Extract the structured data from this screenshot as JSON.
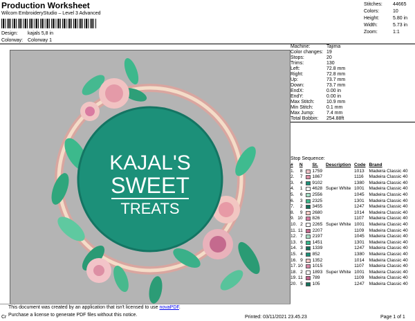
{
  "header": {
    "title": "Production Worksheet",
    "subtitle": "Wilcom EmbroideryStudio – Level 3 Advanced",
    "design_label": "Design:",
    "design_value": "kajals 5,8 in",
    "colorway_label": "Colorway:",
    "colorway_value": "Colorway 1"
  },
  "summary": [
    {
      "label": "Stitches:",
      "value": "44665"
    },
    {
      "label": "Colors:",
      "value": "10"
    },
    {
      "label": "Height:",
      "value": "5.80 in"
    },
    {
      "label": "Width:",
      "value": "5.73 in"
    },
    {
      "label": "Zoom:",
      "value": "1:1"
    }
  ],
  "logo": {
    "line1": "KAJAL'S",
    "line2": "SWEET",
    "line3": "TREATS"
  },
  "machine_info": [
    {
      "label": "Machine:",
      "value": "Tajima"
    },
    {
      "label": "Color changes:",
      "value": "19"
    },
    {
      "label": "Stops:",
      "value": "20"
    },
    {
      "label": "Trims:",
      "value": "130"
    },
    {
      "label": "Left:",
      "value": "72.8 mm"
    },
    {
      "label": "Right:",
      "value": "72.8 mm"
    },
    {
      "label": "Up:",
      "value": "73.7 mm"
    },
    {
      "label": "Down:",
      "value": "73.7 mm"
    },
    {
      "label": "EndX:",
      "value": "0.00 in"
    },
    {
      "label": "EndY:",
      "value": "0.00 in"
    },
    {
      "label": "Max Stitch:",
      "value": "10.9 mm"
    },
    {
      "label": "Min Stitch:",
      "value": "0.1 mm"
    },
    {
      "label": "Max Jump:",
      "value": "7.4 mm"
    },
    {
      "label": "Total Bobbin:",
      "value": "254.88ft"
    }
  ],
  "stop_sequence": {
    "title": "Stop Sequence:",
    "headers": {
      "num": "#",
      "n": "N",
      "st": "St.",
      "desc": "Description",
      "code": "Code",
      "brand": "Brand"
    },
    "rows": [
      {
        "num": "1.",
        "n": "8",
        "color": "#f2c3c8",
        "st": "1759",
        "desc": "",
        "code": "1013",
        "brand": "Madeira Classic 40"
      },
      {
        "num": "2.",
        "n": "7",
        "color": "#dd8fa4",
        "st": "1867",
        "desc": "",
        "code": "1116",
        "brand": "Madeira Classic 40"
      },
      {
        "num": "3.",
        "n": "4",
        "color": "#1c9079",
        "st": "9102",
        "desc": "",
        "code": "1380",
        "brand": "Madeira Classic 40"
      },
      {
        "num": "4.",
        "n": "1",
        "color": "#ffffff",
        "st": "4628",
        "desc": "Super White",
        "code": "1001",
        "brand": "Madeira Classic 40"
      },
      {
        "num": "5.",
        "n": "6",
        "color": "#a6dfc6",
        "st": "2556",
        "desc": "",
        "code": "1045",
        "brand": "Madeira Classic 40"
      },
      {
        "num": "6.",
        "n": "3",
        "color": "#3cba8c",
        "st": "2325",
        "desc": "",
        "code": "1301",
        "brand": "Madeira Classic 40"
      },
      {
        "num": "7.",
        "n": "2",
        "color": "#15705c",
        "st": "3455",
        "desc": "",
        "code": "1247",
        "brand": "Madeira Classic 40"
      },
      {
        "num": "8.",
        "n": "9",
        "color": "#f6ccc6",
        "st": "2680",
        "desc": "",
        "code": "1014",
        "brand": "Madeira Classic 40"
      },
      {
        "num": "9.",
        "n": "10",
        "color": "#d97ba1",
        "st": "826",
        "desc": "",
        "code": "1107",
        "brand": "Madeira Classic 40"
      },
      {
        "num": "10.",
        "n": "2",
        "color": "#ffffff",
        "st": "2265",
        "desc": "Super White",
        "code": "1001",
        "brand": "Madeira Classic 40"
      },
      {
        "num": "11.",
        "n": "11",
        "color": "#c46a8e",
        "st": "2207",
        "desc": "",
        "code": "1109",
        "brand": "Madeira Classic 40"
      },
      {
        "num": "12.",
        "n": "7",
        "color": "#a8dcc4",
        "st": "2197",
        "desc": "",
        "code": "1045",
        "brand": "Madeira Classic 40"
      },
      {
        "num": "13.",
        "n": "6",
        "color": "#35b78a",
        "st": "1451",
        "desc": "",
        "code": "1301",
        "brand": "Madeira Classic 40"
      },
      {
        "num": "14.",
        "n": "3",
        "color": "#17705c",
        "st": "1339",
        "desc": "",
        "code": "1247",
        "brand": "Madeira Classic 40"
      },
      {
        "num": "15.",
        "n": "4",
        "color": "#1d9079",
        "st": "852",
        "desc": "",
        "code": "1380",
        "brand": "Madeira Classic 40"
      },
      {
        "num": "16.",
        "n": "9",
        "color": "#f2c5c4",
        "st": "1352",
        "desc": "",
        "code": "1014",
        "brand": "Madeira Classic 40"
      },
      {
        "num": "17.",
        "n": "10",
        "color": "#d987a6",
        "st": "1015",
        "desc": "",
        "code": "1107",
        "brand": "Madeira Classic 40"
      },
      {
        "num": "18.",
        "n": "2",
        "color": "#ffffff",
        "st": "1893",
        "desc": "Super White",
        "code": "1001",
        "brand": "Madeira Classic 40"
      },
      {
        "num": "19.",
        "n": "11",
        "color": "#c2628a",
        "st": "789",
        "desc": "",
        "code": "1109",
        "brand": "Madeira Classic 40"
      },
      {
        "num": "20.",
        "n": "5",
        "color": "#16725d",
        "st": "105",
        "desc": "",
        "code": "1247",
        "brand": "Madeira Classic 40"
      }
    ]
  },
  "notice": {
    "line1_prefix": "This document was created by an application that isn't licensed to use ",
    "link": "novaPDF",
    "line1_suffix": ".",
    "line2": "Purchase a license to generate PDF files without this notice."
  },
  "footer": {
    "left": "Cr",
    "printed": "Printed: 03/11/2021 23.45.23",
    "page": "Page 1 of 1"
  }
}
